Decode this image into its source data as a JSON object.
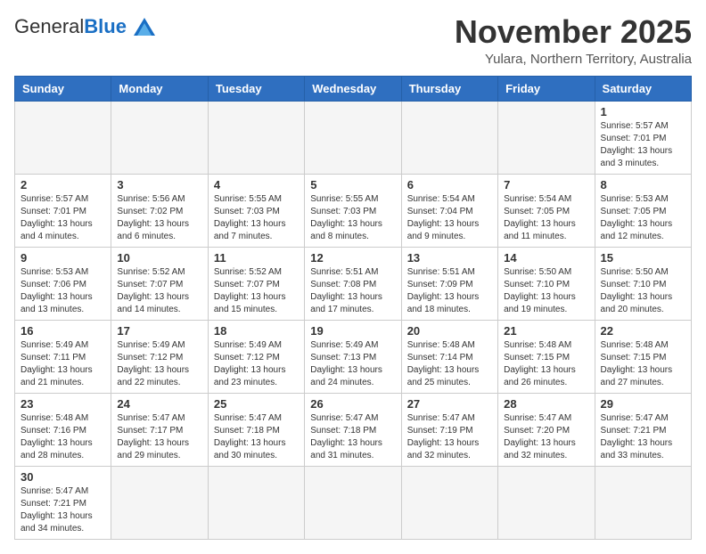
{
  "header": {
    "logo_general": "General",
    "logo_blue": "Blue",
    "month_title": "November 2025",
    "subtitle": "Yulara, Northern Territory, Australia"
  },
  "days_of_week": [
    "Sunday",
    "Monday",
    "Tuesday",
    "Wednesday",
    "Thursday",
    "Friday",
    "Saturday"
  ],
  "weeks": [
    [
      {
        "day": "",
        "info": ""
      },
      {
        "day": "",
        "info": ""
      },
      {
        "day": "",
        "info": ""
      },
      {
        "day": "",
        "info": ""
      },
      {
        "day": "",
        "info": ""
      },
      {
        "day": "",
        "info": ""
      },
      {
        "day": "1",
        "info": "Sunrise: 5:57 AM\nSunset: 7:01 PM\nDaylight: 13 hours and 3 minutes."
      }
    ],
    [
      {
        "day": "2",
        "info": "Sunrise: 5:57 AM\nSunset: 7:01 PM\nDaylight: 13 hours and 4 minutes."
      },
      {
        "day": "3",
        "info": "Sunrise: 5:56 AM\nSunset: 7:02 PM\nDaylight: 13 hours and 6 minutes."
      },
      {
        "day": "4",
        "info": "Sunrise: 5:55 AM\nSunset: 7:03 PM\nDaylight: 13 hours and 7 minutes."
      },
      {
        "day": "5",
        "info": "Sunrise: 5:55 AM\nSunset: 7:03 PM\nDaylight: 13 hours and 8 minutes."
      },
      {
        "day": "6",
        "info": "Sunrise: 5:54 AM\nSunset: 7:04 PM\nDaylight: 13 hours and 9 minutes."
      },
      {
        "day": "7",
        "info": "Sunrise: 5:54 AM\nSunset: 7:05 PM\nDaylight: 13 hours and 11 minutes."
      },
      {
        "day": "8",
        "info": "Sunrise: 5:53 AM\nSunset: 7:05 PM\nDaylight: 13 hours and 12 minutes."
      }
    ],
    [
      {
        "day": "9",
        "info": "Sunrise: 5:53 AM\nSunset: 7:06 PM\nDaylight: 13 hours and 13 minutes."
      },
      {
        "day": "10",
        "info": "Sunrise: 5:52 AM\nSunset: 7:07 PM\nDaylight: 13 hours and 14 minutes."
      },
      {
        "day": "11",
        "info": "Sunrise: 5:52 AM\nSunset: 7:07 PM\nDaylight: 13 hours and 15 minutes."
      },
      {
        "day": "12",
        "info": "Sunrise: 5:51 AM\nSunset: 7:08 PM\nDaylight: 13 hours and 17 minutes."
      },
      {
        "day": "13",
        "info": "Sunrise: 5:51 AM\nSunset: 7:09 PM\nDaylight: 13 hours and 18 minutes."
      },
      {
        "day": "14",
        "info": "Sunrise: 5:50 AM\nSunset: 7:10 PM\nDaylight: 13 hours and 19 minutes."
      },
      {
        "day": "15",
        "info": "Sunrise: 5:50 AM\nSunset: 7:10 PM\nDaylight: 13 hours and 20 minutes."
      }
    ],
    [
      {
        "day": "16",
        "info": "Sunrise: 5:49 AM\nSunset: 7:11 PM\nDaylight: 13 hours and 21 minutes."
      },
      {
        "day": "17",
        "info": "Sunrise: 5:49 AM\nSunset: 7:12 PM\nDaylight: 13 hours and 22 minutes."
      },
      {
        "day": "18",
        "info": "Sunrise: 5:49 AM\nSunset: 7:12 PM\nDaylight: 13 hours and 23 minutes."
      },
      {
        "day": "19",
        "info": "Sunrise: 5:49 AM\nSunset: 7:13 PM\nDaylight: 13 hours and 24 minutes."
      },
      {
        "day": "20",
        "info": "Sunrise: 5:48 AM\nSunset: 7:14 PM\nDaylight: 13 hours and 25 minutes."
      },
      {
        "day": "21",
        "info": "Sunrise: 5:48 AM\nSunset: 7:15 PM\nDaylight: 13 hours and 26 minutes."
      },
      {
        "day": "22",
        "info": "Sunrise: 5:48 AM\nSunset: 7:15 PM\nDaylight: 13 hours and 27 minutes."
      }
    ],
    [
      {
        "day": "23",
        "info": "Sunrise: 5:48 AM\nSunset: 7:16 PM\nDaylight: 13 hours and 28 minutes."
      },
      {
        "day": "24",
        "info": "Sunrise: 5:47 AM\nSunset: 7:17 PM\nDaylight: 13 hours and 29 minutes."
      },
      {
        "day": "25",
        "info": "Sunrise: 5:47 AM\nSunset: 7:18 PM\nDaylight: 13 hours and 30 minutes."
      },
      {
        "day": "26",
        "info": "Sunrise: 5:47 AM\nSunset: 7:18 PM\nDaylight: 13 hours and 31 minutes."
      },
      {
        "day": "27",
        "info": "Sunrise: 5:47 AM\nSunset: 7:19 PM\nDaylight: 13 hours and 32 minutes."
      },
      {
        "day": "28",
        "info": "Sunrise: 5:47 AM\nSunset: 7:20 PM\nDaylight: 13 hours and 32 minutes."
      },
      {
        "day": "29",
        "info": "Sunrise: 5:47 AM\nSunset: 7:21 PM\nDaylight: 13 hours and 33 minutes."
      }
    ],
    [
      {
        "day": "30",
        "info": "Sunrise: 5:47 AM\nSunset: 7:21 PM\nDaylight: 13 hours and 34 minutes."
      },
      {
        "day": "",
        "info": ""
      },
      {
        "day": "",
        "info": ""
      },
      {
        "day": "",
        "info": ""
      },
      {
        "day": "",
        "info": ""
      },
      {
        "day": "",
        "info": ""
      },
      {
        "day": "",
        "info": ""
      }
    ]
  ]
}
